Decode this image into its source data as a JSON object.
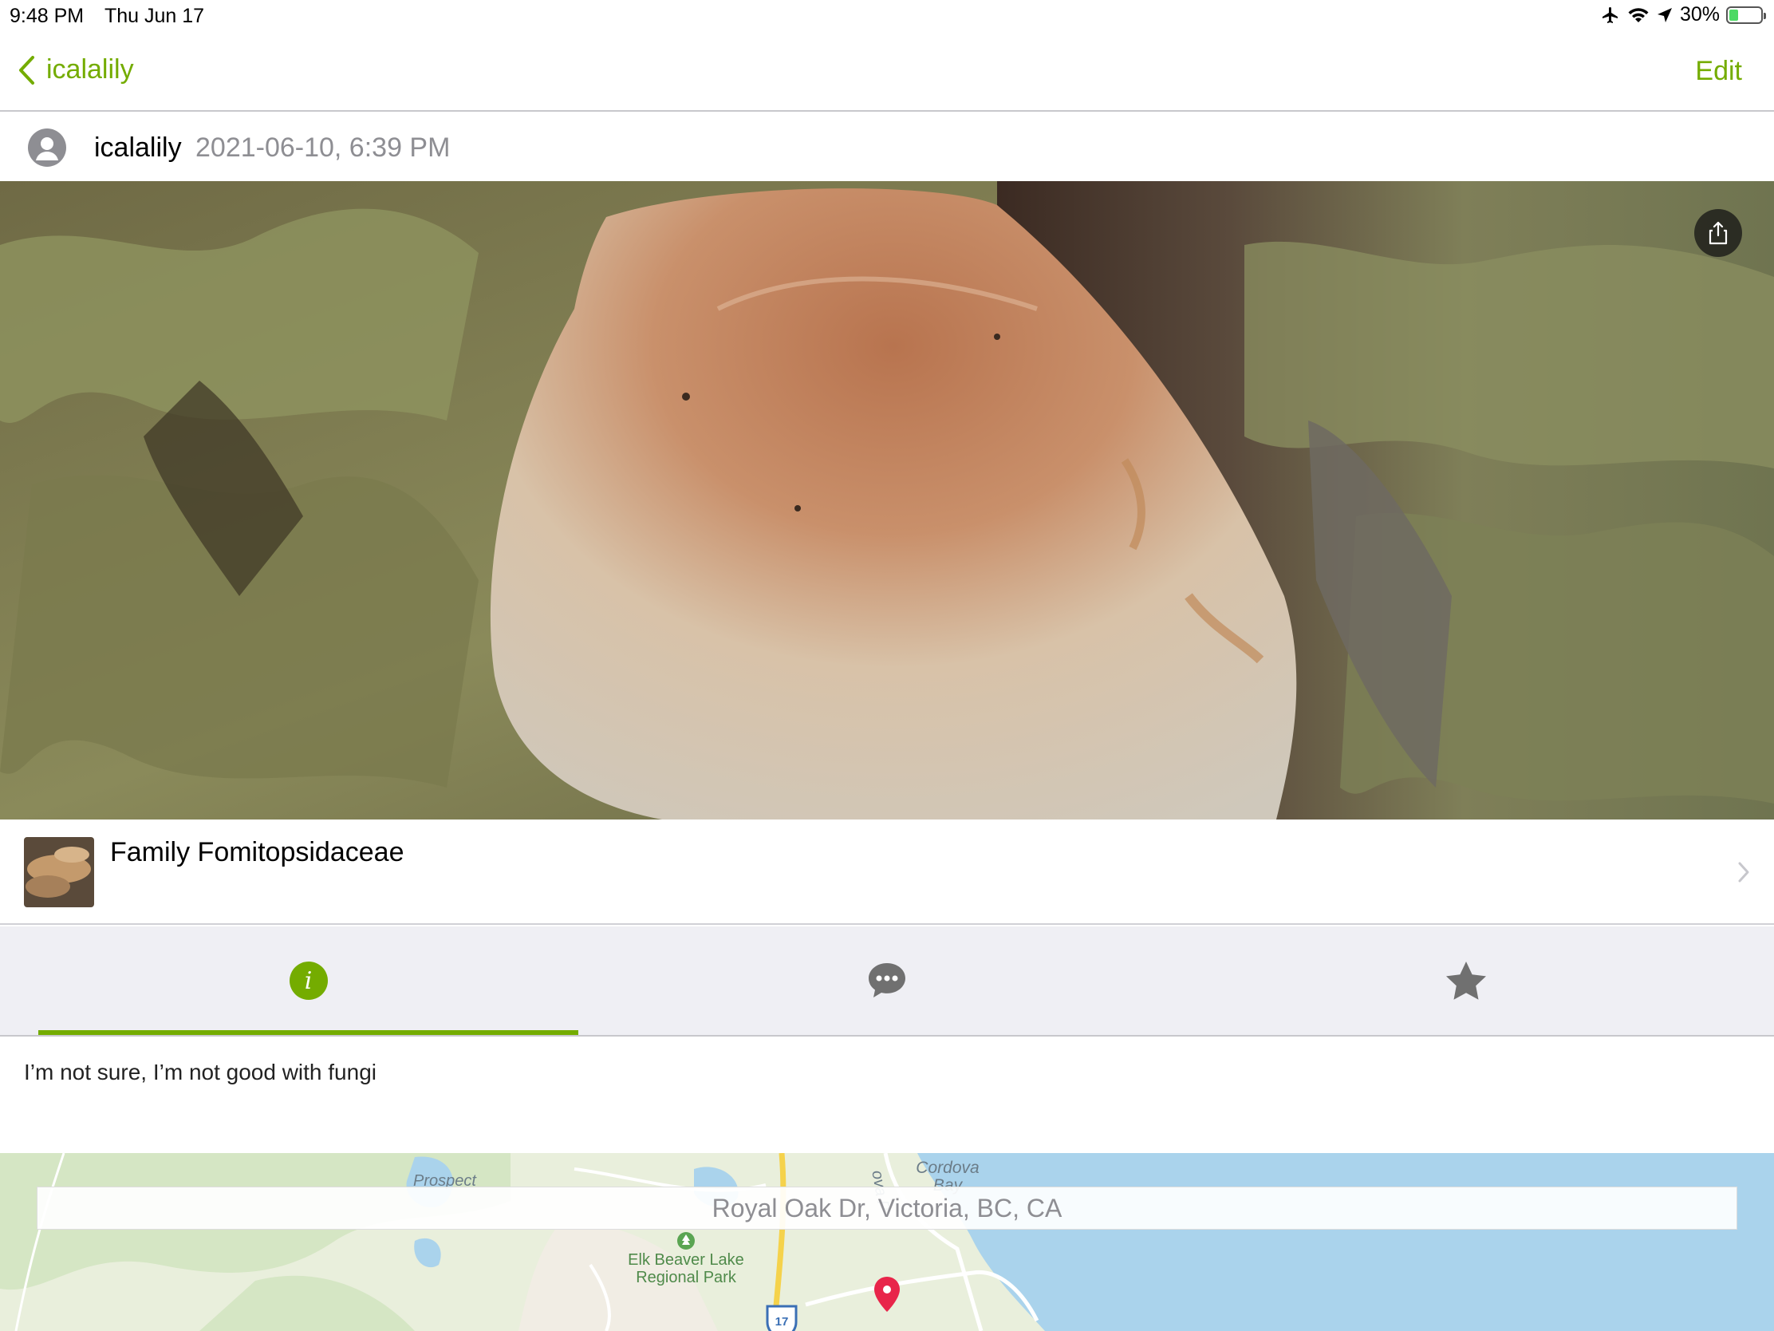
{
  "status_bar": {
    "time": "9:48 PM",
    "date": "Thu Jun 17",
    "battery": "30%",
    "battery_level": 0.3
  },
  "nav": {
    "back_label": "icalalily",
    "edit_label": "Edit",
    "accent_color": "#74ac00"
  },
  "observation": {
    "user": "icalalily",
    "datetime": "2021-06-10, 6:39 PM",
    "taxon": "Family Fomitopsidaceae",
    "description": "I’m not sure, I’m not good with fungi"
  },
  "tabs": [
    {
      "icon": "info-icon",
      "label": "i",
      "active": true
    },
    {
      "icon": "comment-icon",
      "active": false
    },
    {
      "icon": "star-icon",
      "active": false
    }
  ],
  "map": {
    "location": "Royal Oak Dr, Victoria, BC, CA",
    "labels": {
      "prospect": "Prospect",
      "cordova_bay": "Cordova Bay",
      "park_line1": "Elk Beaver Lake",
      "park_line2": "Regional Park",
      "road_fragment": "ova P",
      "highway": "17"
    }
  }
}
